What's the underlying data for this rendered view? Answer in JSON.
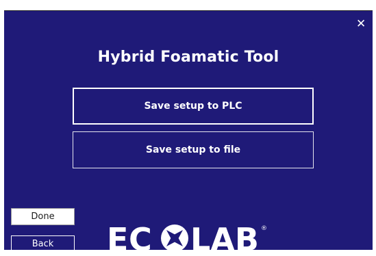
{
  "dialog": {
    "title": "Hybrid Foamatic Tool",
    "close_glyph": "✕",
    "close_icon": "close-icon",
    "background_color": "#1f1a78"
  },
  "actions": {
    "save_to_plc_label": "Save setup to PLC",
    "save_to_file_label": "Save setup to file"
  },
  "footer": {
    "done_label": "Done",
    "back_label": "Back"
  },
  "logo": {
    "text": "ECOLAB",
    "registered_mark": "®"
  }
}
